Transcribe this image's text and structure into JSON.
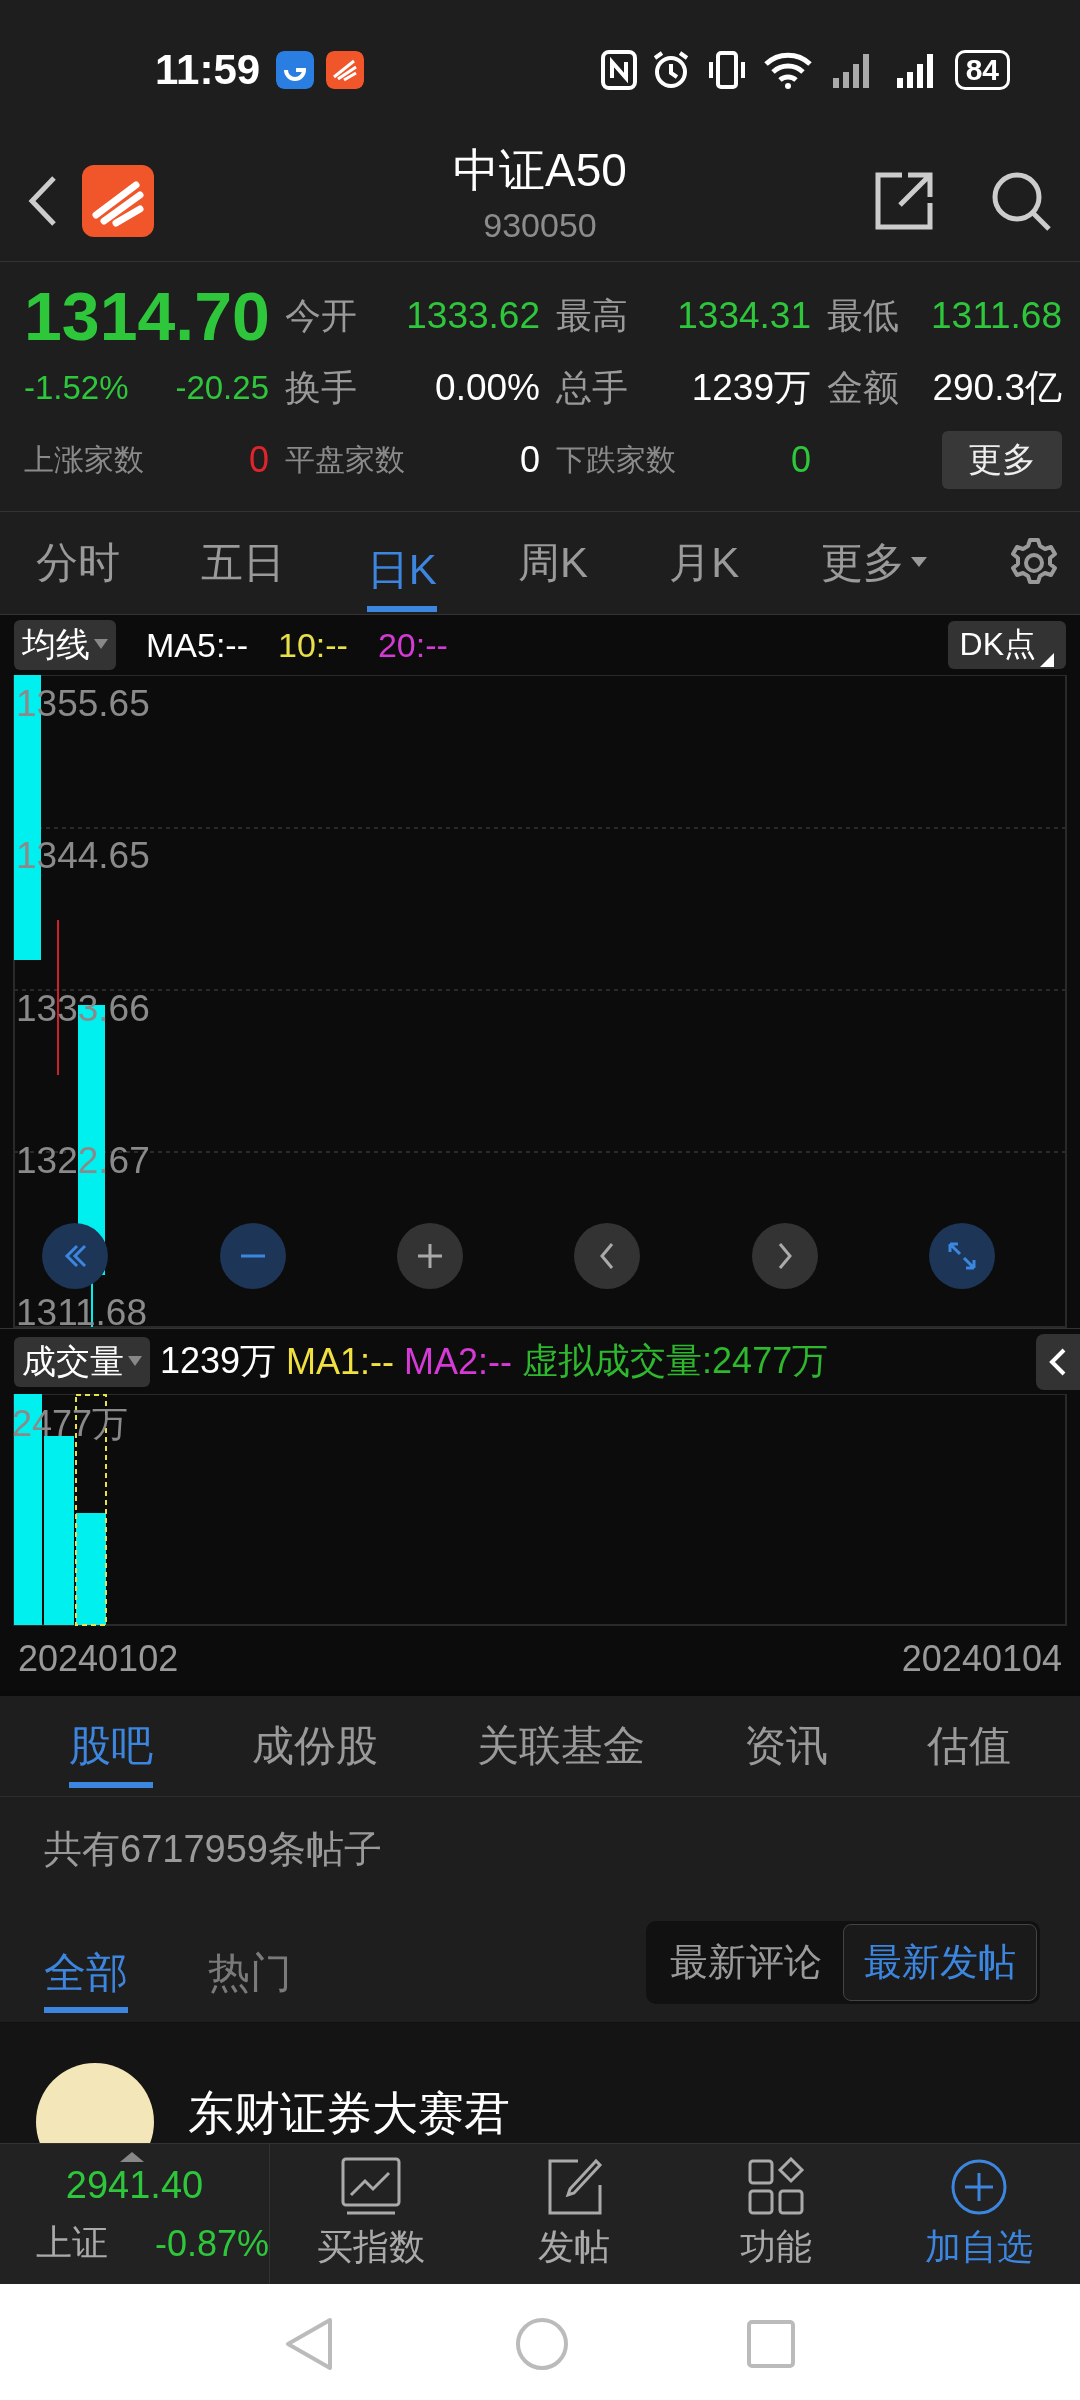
{
  "status_bar": {
    "time": "11:59",
    "battery": "84"
  },
  "header": {
    "title": "中证A50",
    "code": "930050"
  },
  "quote": {
    "price": "1314.70",
    "change_pct": "-1.52%",
    "change": "-20.25",
    "stats": [
      {
        "label": "今开",
        "value": "1333.62",
        "color": "#2ec73b"
      },
      {
        "label": "最高",
        "value": "1334.31",
        "color": "#2ec73b"
      },
      {
        "label": "最低",
        "value": "1311.68",
        "color": "#2ec73b"
      },
      {
        "label": "换手",
        "value": "0.00%",
        "color": "#ffffff"
      },
      {
        "label": "总手",
        "value": "1239万",
        "color": "#ffffff"
      },
      {
        "label": "金额",
        "value": "290.3亿",
        "color": "#ffffff"
      }
    ],
    "counts": [
      {
        "label": "上涨家数",
        "value": "0",
        "color": "#e0242c"
      },
      {
        "label": "平盘家数",
        "value": "0",
        "color": "#ffffff"
      },
      {
        "label": "下跌家数",
        "value": "0",
        "color": "#2ec73b"
      }
    ],
    "more_button": "更多"
  },
  "period_tabs": [
    {
      "label": "分时",
      "selected": false,
      "kind": "tab"
    },
    {
      "label": "五日",
      "selected": false,
      "kind": "tab"
    },
    {
      "label": "日K",
      "selected": true,
      "kind": "tab"
    },
    {
      "label": "周K",
      "selected": false,
      "kind": "tab"
    },
    {
      "label": "月K",
      "selected": false,
      "kind": "tab"
    },
    {
      "label": "更多",
      "selected": false,
      "kind": "dropdown"
    }
  ],
  "ma_bar": {
    "selector": "均线",
    "items": [
      {
        "text": "MA5:--",
        "color": "#ffffff"
      },
      {
        "text": "10:--",
        "color": "#e8e04a"
      },
      {
        "text": "20:--",
        "color": "#d63ad6"
      }
    ],
    "dk_button": "DK点"
  },
  "price_axis": [
    "1355.65",
    "1344.65",
    "1333.66",
    "1322.67",
    "1311.68"
  ],
  "volume_bar": {
    "selector": "成交量",
    "items": [
      {
        "text": "1239万",
        "color": "#ffffff"
      },
      {
        "text": "MA1:--",
        "color": "#f0e040"
      },
      {
        "text": "MA2:--",
        "color": "#d63ad6"
      },
      {
        "text": "虚拟成交量:2477万",
        "color": "#2eb82e"
      }
    ]
  },
  "volume_axis_label": "2477万",
  "dates": [
    "20240102",
    "20240104"
  ],
  "section_tabs": [
    {
      "label": "股吧",
      "selected": true
    },
    {
      "label": "成份股",
      "selected": false
    },
    {
      "label": "关联基金",
      "selected": false
    },
    {
      "label": "资讯",
      "selected": false
    },
    {
      "label": "估值",
      "selected": false
    }
  ],
  "post_count": "共有6717959条帖子",
  "filter_tabs": [
    {
      "label": "全部",
      "selected": true
    },
    {
      "label": "热门",
      "selected": false
    }
  ],
  "sort_options": [
    {
      "label": "最新评论",
      "selected": false
    },
    {
      "label": "最新发帖",
      "selected": true
    }
  ],
  "post": {
    "author": "东财证券大赛君"
  },
  "bottom_bar": {
    "index": {
      "value": "2941.40",
      "name": "上证",
      "change": "-0.87%"
    },
    "actions": [
      {
        "label": "买指数",
        "kind": "chart",
        "accent": false
      },
      {
        "label": "发帖",
        "kind": "edit",
        "accent": false
      },
      {
        "label": "功能",
        "kind": "grid",
        "accent": false
      },
      {
        "label": "加自选",
        "kind": "add",
        "accent": true
      }
    ]
  }
}
